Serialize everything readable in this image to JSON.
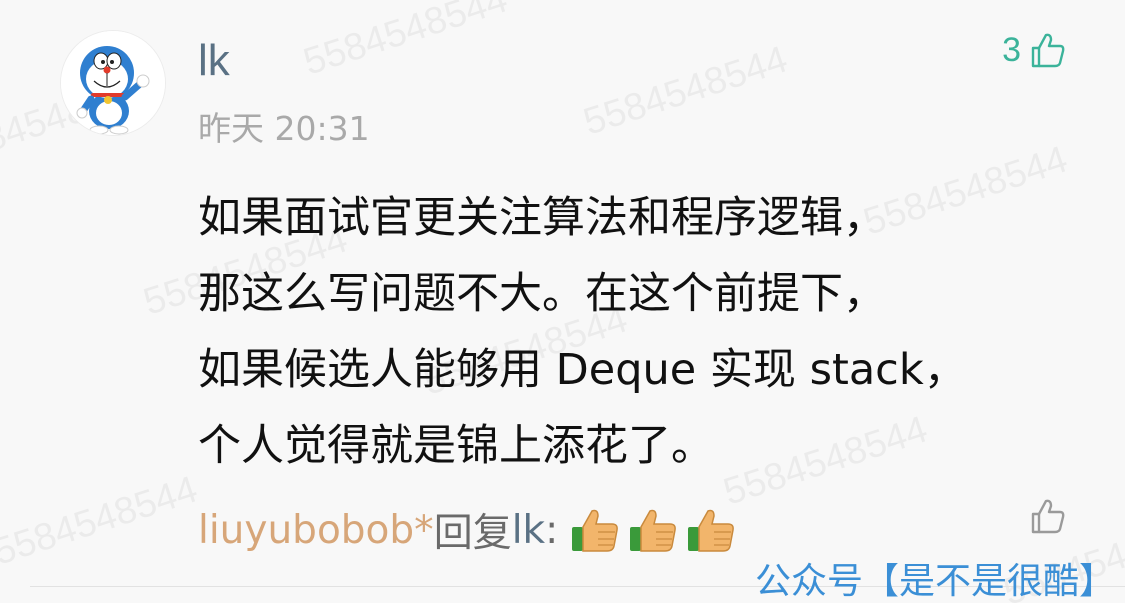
{
  "comment": {
    "username": "lk",
    "timestamp": "昨天 20:31",
    "like_count": "3",
    "body_lines": [
      "如果面试官更关注算法和程序逻辑，",
      "那这么写问题不大。在这个前提下，",
      "如果候选人能够用 Deque 实现 stack，",
      "个人觉得就是锦上添花了。"
    ]
  },
  "reply": {
    "author": "liuyubobob*",
    "verb": "回复",
    "target": "lk",
    "colon": ":",
    "emojis": [
      "thumbs-up-icon",
      "thumbs-up-icon",
      "thumbs-up-icon"
    ]
  },
  "watermark_text": "5584548544",
  "source_tag": "公众号【是不是很酷】",
  "colors": {
    "username": "#5a7184",
    "reply_author": "#d7a679",
    "like_count": "#3bb39a",
    "source_tag": "#3b8fd6"
  }
}
